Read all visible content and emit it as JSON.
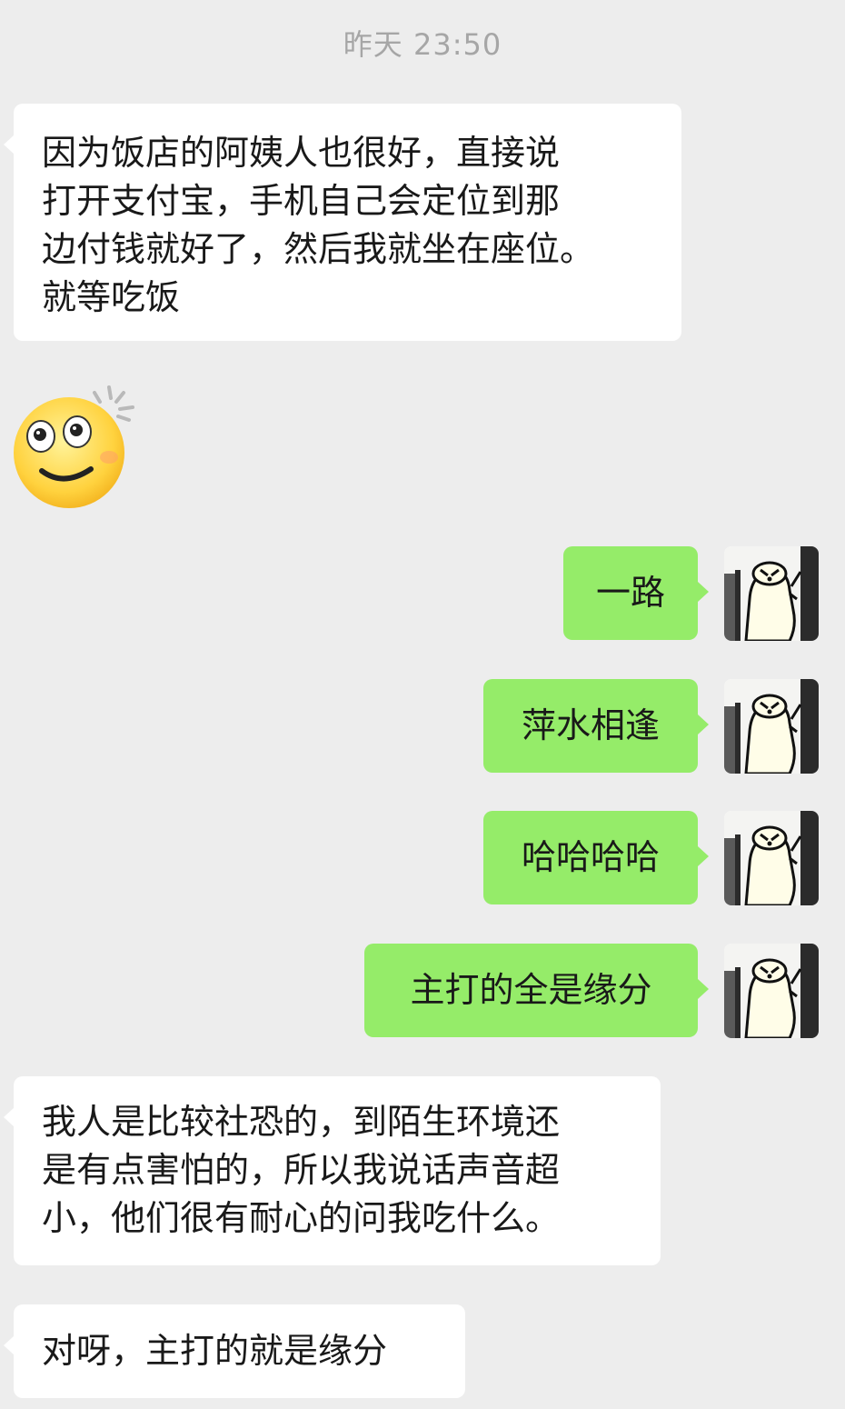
{
  "timestamp": "昨天 23:50",
  "messages": {
    "m1": {
      "lines": [
        "因为饭店的阿姨人也很好，直接说",
        "打开支付宝，手机自己会定位到那",
        "边付钱就好了，然后我就坐在座位。",
        "就等吃饭"
      ]
    },
    "m2": {
      "icon": "dizzy-smile-emoji-icon"
    },
    "m3": {
      "text": "一路"
    },
    "m4": {
      "text": "萍水相逢"
    },
    "m5": {
      "text": "哈哈哈哈"
    },
    "m6": {
      "text": "主打的全是缘分"
    },
    "m7": {
      "lines": [
        "我人是比较社恐的，到陌生环境还",
        "是有点害怕的，所以我说话声音超",
        "小，他们很有耐心的问我吃什么。"
      ]
    },
    "m8": {
      "text": "对呀，主打的就是缘分"
    }
  },
  "avatar": {
    "icon": "bear-avatar-icon"
  },
  "colors": {
    "background": "#ededed",
    "incoming_bubble": "#ffffff",
    "outgoing_bubble": "#95ec69",
    "timestamp": "#a6a6a6"
  }
}
